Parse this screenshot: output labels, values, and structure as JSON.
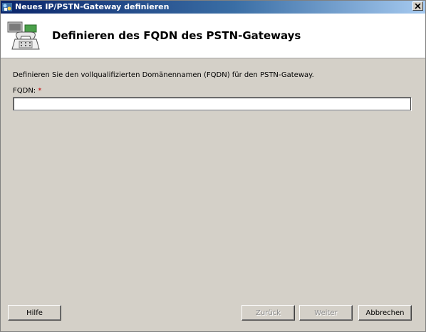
{
  "window": {
    "title": "Neues IP/PSTN-Gateway definieren",
    "close_icon": "close-icon"
  },
  "header": {
    "heading": "Definieren des FQDN des PSTN-Gateways",
    "icon": "telephone-gateway-icon"
  },
  "main": {
    "description": "Definieren Sie den vollqualifizierten Domänennamen (FQDN) für den PSTN-Gateway.",
    "fqdn_label": "FQDN:",
    "required_marker": "*",
    "fqdn_value": ""
  },
  "buttons": {
    "help": "Hilfe",
    "back": "Zurück",
    "next": "Weiter",
    "cancel": "Abbrechen"
  },
  "colors": {
    "title_bar": "#0a246a",
    "dialog_bg": "#d4d0c8",
    "required": "#c00000"
  }
}
